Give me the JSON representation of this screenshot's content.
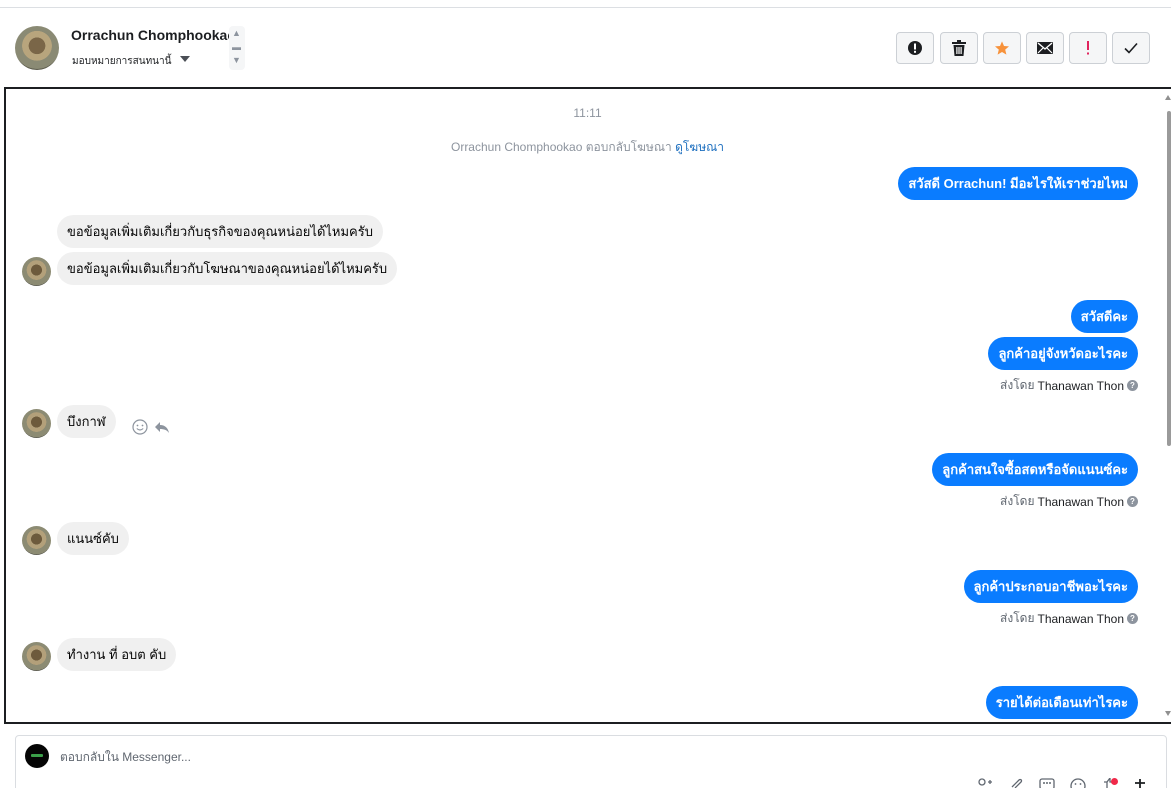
{
  "header": {
    "contact_name": "Orrachun Chomphookao",
    "assign_label": "มอบหมายการสนทนานี้",
    "actions": [
      {
        "name": "spam-icon"
      },
      {
        "name": "trash-icon"
      },
      {
        "name": "star-icon",
        "color": "#f7923b"
      },
      {
        "name": "envelope-icon"
      },
      {
        "name": "exclamation-icon",
        "color": "#e0245e"
      },
      {
        "name": "check-icon"
      }
    ]
  },
  "conversation": {
    "time": "11:11",
    "ad_notice": "Orrachun Chomphookao ตอบกลับโฆษณา",
    "ad_link": "ดูโฆษณา",
    "messages": [
      {
        "dir": "out",
        "text": "สวัสดี Orrachun! มีอะไรให้เราช่วยไหม"
      },
      {
        "dir": "in",
        "text": "ขอข้อมูลเพิ่มเติมเกี่ยวกับธุรกิจของคุณหน่อยได้ไหมครับ"
      },
      {
        "dir": "in",
        "text": "ขอข้อมูลเพิ่มเติมเกี่ยวกับโฆษณาของคุณหน่อยได้ไหมครับ"
      },
      {
        "dir": "out",
        "text": "สวัสดีคะ"
      },
      {
        "dir": "out",
        "text": "ลูกค้าอยู่จังหวัดอะไรคะ"
      },
      {
        "dir": "in",
        "text": "บึงกาฬ"
      },
      {
        "dir": "out",
        "text": "ลูกค้าสนใจซื้อสดหรือจัดแนนซ์คะ"
      },
      {
        "dir": "in",
        "text": "แนนซ์คับ"
      },
      {
        "dir": "out",
        "text": "ลูกค้าประกอบอาชีพอะไรคะ"
      },
      {
        "dir": "in",
        "text": "ทำงาน ที่ อบต คับ"
      },
      {
        "dir": "out",
        "text": "รายได้ต่อเดือนเท่าไรคะ"
      }
    ],
    "sent_by_prefix": "ส่งโดย",
    "sent_by_name": "Thanawan Thon"
  },
  "composer": {
    "placeholder": "ตอบกลับใน Messenger..."
  },
  "colors": {
    "outgoing_bubble": "#0a7cff",
    "incoming_bubble": "#f0f0f0",
    "link": "#1d6fbf"
  }
}
